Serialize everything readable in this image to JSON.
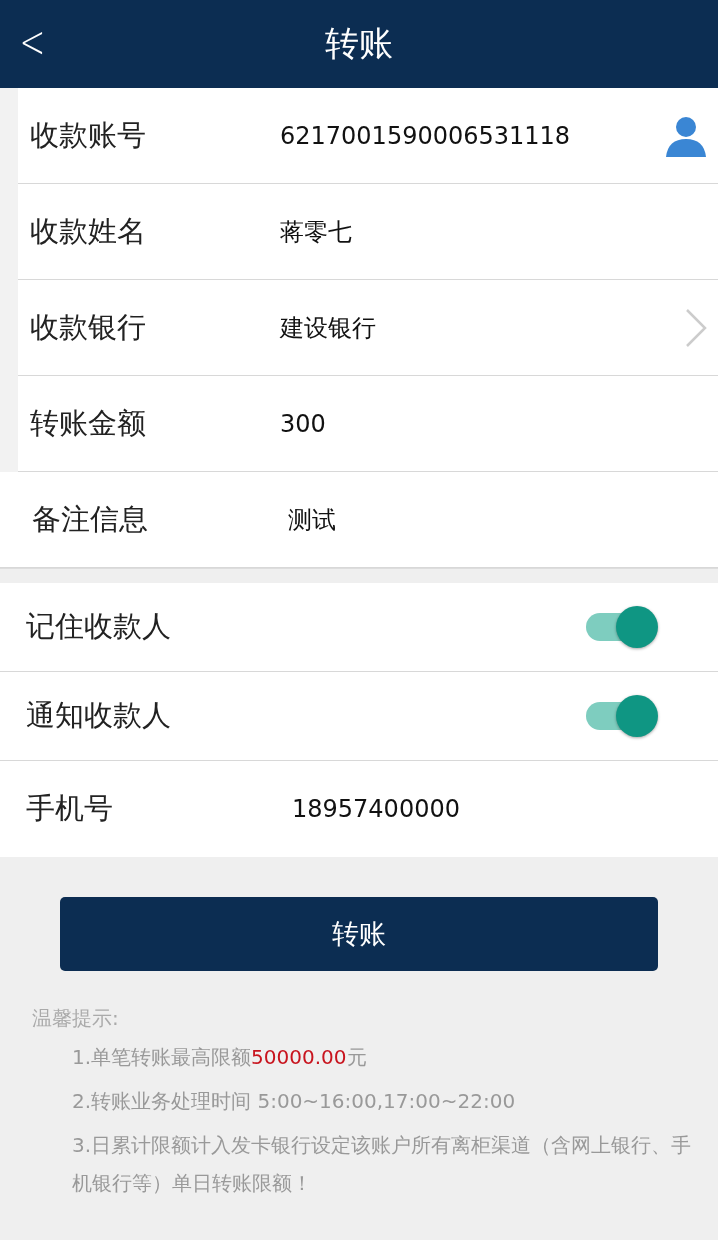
{
  "header": {
    "back": "<",
    "title": "转账"
  },
  "fields": [
    {
      "label": "收款账号",
      "value": "6217001590006531118",
      "kind": "contact",
      "indented": true
    },
    {
      "label": "收款姓名",
      "value": "蒋零七",
      "kind": "plain",
      "indented": true
    },
    {
      "label": "收款银行",
      "value": "建设银行",
      "kind": "select",
      "indented": true
    },
    {
      "label": "转账金额",
      "value": "300",
      "kind": "plain",
      "indented": true
    },
    {
      "label": "备注信息",
      "value": "测试",
      "kind": "plain",
      "indented": false
    }
  ],
  "toggles": [
    {
      "label": "记住收款人",
      "on": true
    },
    {
      "label": "通知收款人",
      "on": true
    }
  ],
  "phone": {
    "label": "手机号",
    "value": "18957400000"
  },
  "submit": "转账",
  "tips": {
    "title": "温馨提示:",
    "lines": [
      [
        {
          "text": "1.单笔转账最高限额",
          "highlight": false
        },
        {
          "text": "50000.00",
          "highlight": true
        },
        {
          "text": "元",
          "highlight": false
        }
      ],
      [
        {
          "text": "2.转账业务处理时间 5:00~16:00,17:00~22:00",
          "highlight": false
        }
      ],
      [
        {
          "text": "3.日累计限额计入发卡银行设定该账户所有离柜渠道（含网上银行、手机银行等）单日转账限额！",
          "highlight": false
        }
      ]
    ]
  }
}
